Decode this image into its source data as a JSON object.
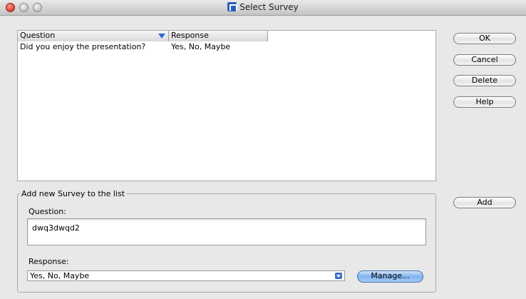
{
  "window": {
    "title": "Select Survey"
  },
  "table": {
    "columns": [
      "Question",
      "Response"
    ],
    "rows": [
      {
        "question": "Did you enjoy the presentation?",
        "response": "Yes, No, Maybe"
      }
    ]
  },
  "buttons": {
    "ok": "OK",
    "cancel": "Cancel",
    "delete": "Delete",
    "help": "Help",
    "add": "Add",
    "manage": "Manage..."
  },
  "add_section": {
    "legend": "Add new Survey to the list",
    "question_label": "Question:",
    "question_value": "dwq3dwqd2",
    "response_label": "Response:",
    "response_value": "Yes, No, Maybe"
  }
}
